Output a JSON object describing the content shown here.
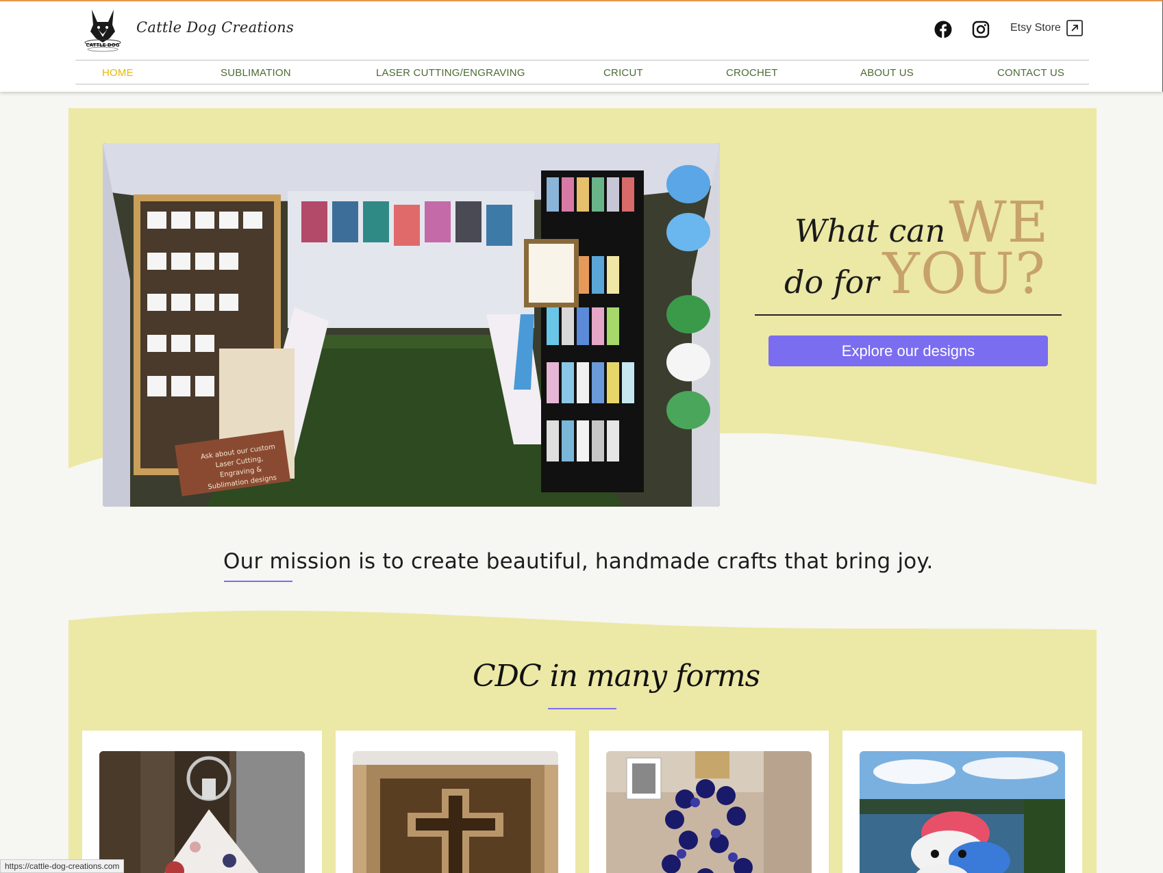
{
  "header": {
    "site_title": "Cattle Dog Creations",
    "logo_text": "CATTLE DOG",
    "etsy_label": "Etsy Store",
    "icons": [
      "facebook-icon",
      "instagram-icon",
      "external-link-icon"
    ]
  },
  "nav": {
    "items": [
      {
        "label": "HOME",
        "active": true
      },
      {
        "label": "SUBLIMATION",
        "active": false
      },
      {
        "label": "LASER CUTTING/ENGRAVING",
        "active": false
      },
      {
        "label": "CRICUT",
        "active": false
      },
      {
        "label": "CROCHET",
        "active": false
      },
      {
        "label": "ABOUT US",
        "active": false
      },
      {
        "label": "CONTACT US",
        "active": false
      }
    ]
  },
  "hero": {
    "line1_small": "What can",
    "line1_big": "WE",
    "line2_small": "do for",
    "line2_big": "YOU?",
    "cta_label": "Explore our designs",
    "sign_text": "Ask about our custom Laser Cutting, Engraving & Sublimation designs"
  },
  "mission": {
    "text": "Our mission is to create beautiful, handmade crafts that bring joy."
  },
  "forms_section": {
    "title": "CDC in many forms"
  },
  "status_bar": {
    "url": "https://cattle-dog-creations.com"
  },
  "colors": {
    "accent": "#7b6df0",
    "hero_bg": "#ece8a6",
    "nav_text": "#4a6b34",
    "nav_active": "#e8b800",
    "gold": "#c6a26a",
    "page_bg": "#f6f6f2"
  }
}
